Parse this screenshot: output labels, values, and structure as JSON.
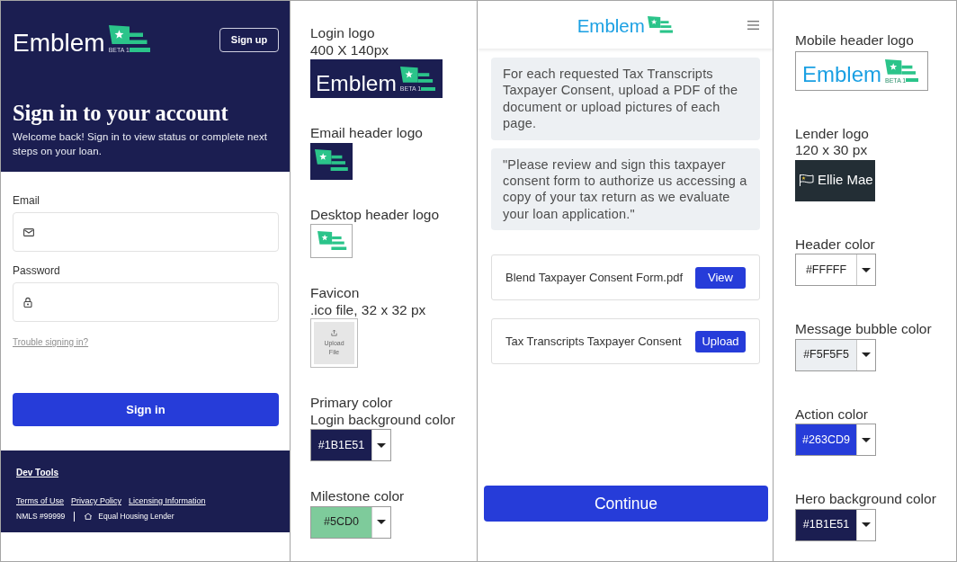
{
  "login_preview": {
    "logo": {
      "wordmark": "Emblem",
      "badge": "BETA 1"
    },
    "sign_up_button": "Sign up",
    "title": "Sign in to your account",
    "subtitle": "Welcome back! Sign in to view status or complete next steps on your loan.",
    "fields": [
      {
        "kind": "email",
        "label": "Email"
      },
      {
        "kind": "password",
        "label": "Password"
      }
    ],
    "help_link": "Trouble signing in?",
    "submit_button": "Sign in",
    "footer": {
      "dev_link": "Dev Tools",
      "links": [
        "Terms of Use",
        "Privacy Policy",
        "Licensing Information"
      ],
      "nmls": "NMLS #99999",
      "housing": "Equal Housing Lender"
    }
  },
  "branding_left": [
    {
      "kind": "banner",
      "labels": [
        "Login logo",
        "400 X 140px"
      ],
      "wordmark": "Emblem",
      "badge": "BETA 1"
    },
    {
      "kind": "tile",
      "labels": [
        "Email header logo"
      ]
    },
    {
      "kind": "framed",
      "labels": [
        "Desktop header logo"
      ]
    },
    {
      "kind": "upload",
      "labels": [
        "Favicon",
        ".ico file, 32 x 32 px"
      ],
      "button": "Upload File"
    },
    {
      "kind": "color",
      "labels": [
        "Primary color",
        "Login background color"
      ],
      "value": "#1B1E51",
      "color": "#1b1e51"
    },
    {
      "kind": "color",
      "labels": [
        "Milestone color"
      ],
      "value": "#5CD0",
      "color": "#7ecb9b"
    }
  ],
  "mobile_preview": {
    "logo": {
      "wordmark": "Emblem"
    },
    "messages": [
      "For each requested Tax Transcripts Taxpayer Consent, upload a PDF of the document or upload pictures of each page.",
      "\"Please review and sign this taxpayer consent form to authorize us accessing a copy of your tax return as we evaluate your loan application.\""
    ],
    "documents": [
      {
        "name": "Blend Taxpayer Consent Form.pdf",
        "action": "View"
      },
      {
        "name": "Tax Transcripts Taxpayer Consent",
        "action": "Upload"
      }
    ],
    "continue_button": "Continue"
  },
  "branding_right": [
    {
      "kind": "boxed",
      "labels": [
        "Mobile header logo"
      ],
      "wordmark": "Emblem",
      "badge": "BETA 1"
    },
    {
      "kind": "lender",
      "labels": [
        "Lender logo",
        "120 x 30 px"
      ],
      "wordmark": "Ellie Mae"
    },
    {
      "kind": "color",
      "labels": [
        "Header color"
      ],
      "value": "#FFFFF",
      "color": "#ffffff"
    },
    {
      "kind": "color",
      "labels": [
        "Message bubble color"
      ],
      "value": "#F5F5F5",
      "color": "#eceff2"
    },
    {
      "kind": "color",
      "labels": [
        "Action color"
      ],
      "value": "#263CD9",
      "color": "#263cd9"
    },
    {
      "kind": "color",
      "labels": [
        "Hero background color"
      ],
      "value": "#1B1E51",
      "color": "#1b1e51"
    }
  ]
}
